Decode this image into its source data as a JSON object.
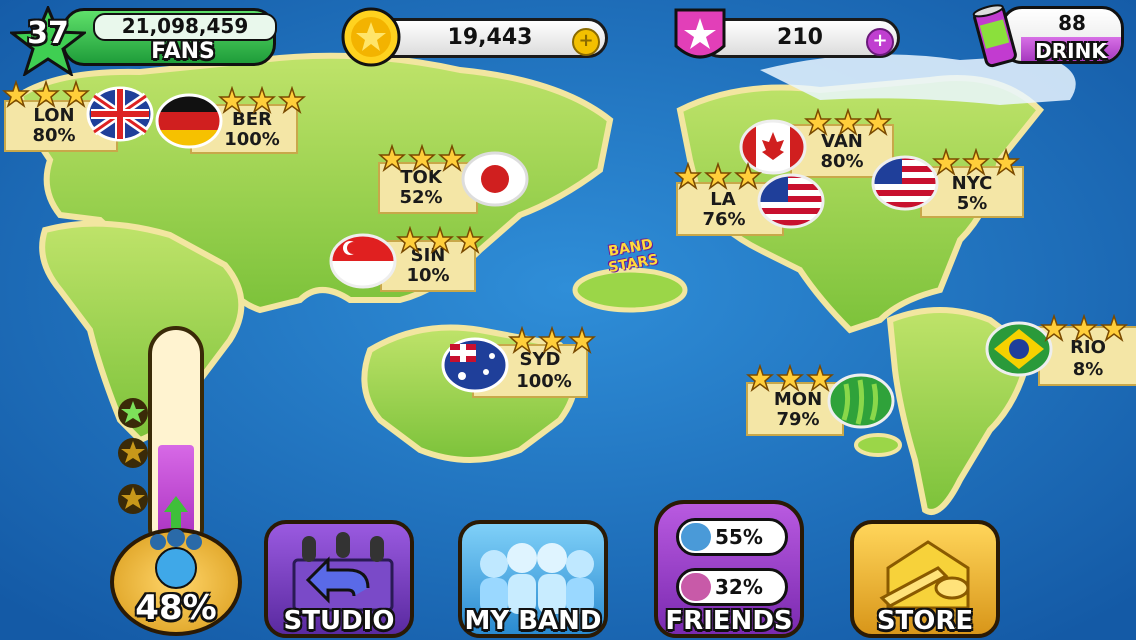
{
  "hud": {
    "level": "37",
    "fans_count": "21,098,459",
    "fans_label": "FANS",
    "coins": "19,443",
    "stars": "210",
    "drink_count": "88",
    "drink_label": "DRINK"
  },
  "cities": [
    {
      "code": "LON",
      "percent": "80%"
    },
    {
      "code": "BER",
      "percent": "100%"
    },
    {
      "code": "TOK",
      "percent": "52%"
    },
    {
      "code": "SIN",
      "percent": "10%"
    },
    {
      "code": "SYD",
      "percent": "100%"
    },
    {
      "code": "VAN",
      "percent": "80%"
    },
    {
      "code": "LA",
      "percent": "76%"
    },
    {
      "code": "NYC",
      "percent": "5%"
    },
    {
      "code": "MON",
      "percent": "79%"
    },
    {
      "code": "RIO",
      "percent": "8%"
    }
  ],
  "island_logo": [
    "BAND",
    "STARS"
  ],
  "meter": {
    "percent_label": "48%",
    "fill_fraction": 0.48
  },
  "nav": {
    "studio": "STUDIO",
    "my_band": "MY BAND",
    "friends": "FRIENDS",
    "store": "STORE",
    "friend1_percent": "55%",
    "friend2_percent": "32%"
  },
  "colors": {
    "ocean": "#1b6fc0",
    "land": "#8fcf3c",
    "fans_green": "#2fb84a",
    "drink_purple": "#b03fc8",
    "meter_fill": "#c23bd0"
  }
}
